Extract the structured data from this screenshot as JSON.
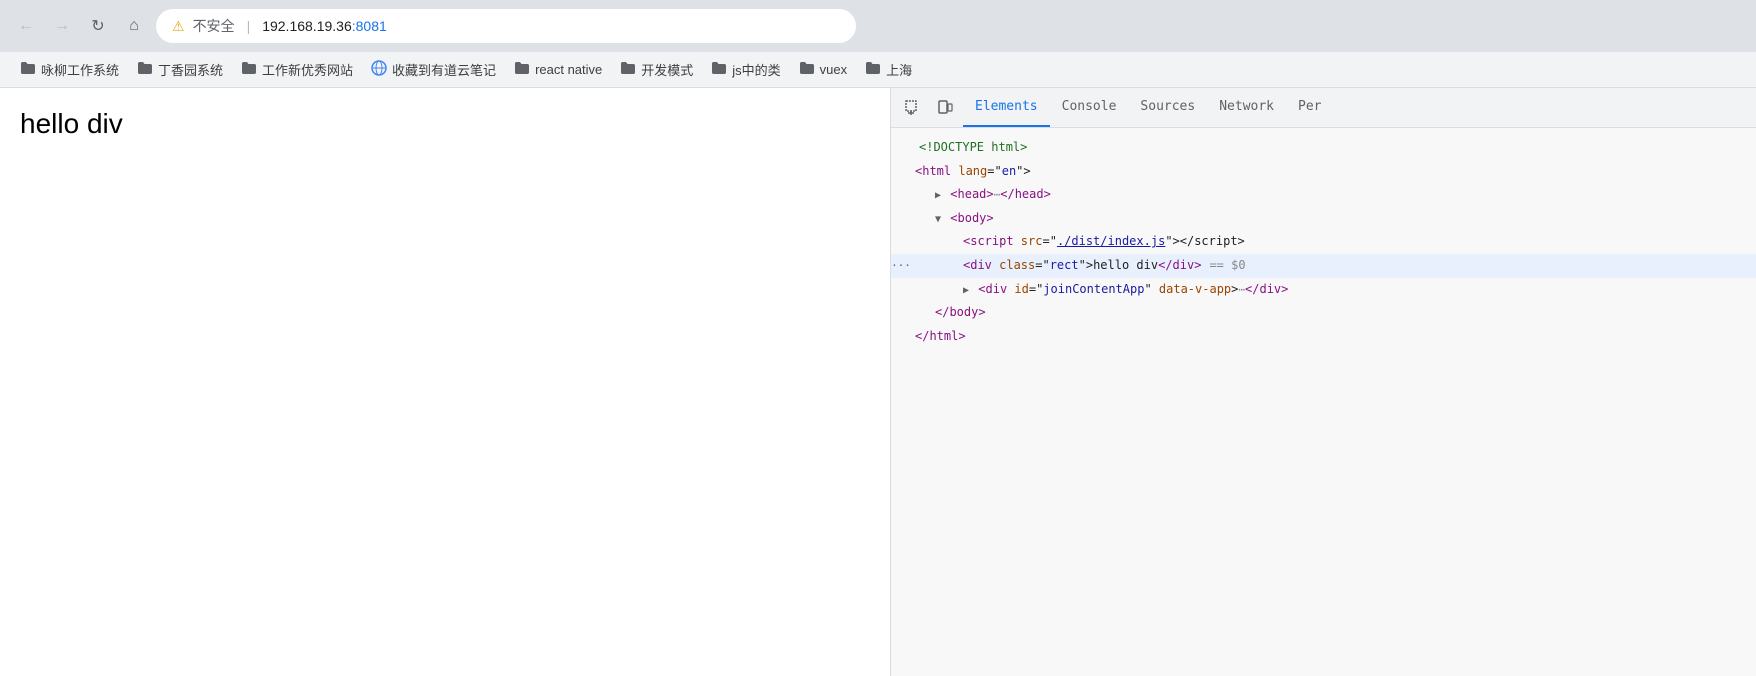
{
  "browser": {
    "back_disabled": true,
    "forward_disabled": true,
    "address": {
      "warning_label": "不安全",
      "separator": "|",
      "host": "192.168.19.36",
      "port": ":8081"
    },
    "bookmarks": [
      {
        "id": "b1",
        "icon": "folder",
        "label": "咏柳工作系统"
      },
      {
        "id": "b2",
        "icon": "folder",
        "label": "丁香园系统"
      },
      {
        "id": "b3",
        "icon": "folder",
        "label": "工作新优秀网站"
      },
      {
        "id": "b4",
        "icon": "globe",
        "label": "收藏到有道云笔记"
      },
      {
        "id": "b5",
        "icon": "folder",
        "label": "react native"
      },
      {
        "id": "b6",
        "icon": "folder",
        "label": "开发模式"
      },
      {
        "id": "b7",
        "icon": "folder",
        "label": "js中的类"
      },
      {
        "id": "b8",
        "icon": "folder",
        "label": "vuex"
      },
      {
        "id": "b9",
        "icon": "folder",
        "label": "上海"
      }
    ]
  },
  "page": {
    "content": "hello  div"
  },
  "devtools": {
    "icons": {
      "inspect": "⬚",
      "device": "⬜"
    },
    "tabs": [
      {
        "id": "elements",
        "label": "Elements",
        "active": true
      },
      {
        "id": "console",
        "label": "Console",
        "active": false
      },
      {
        "id": "sources",
        "label": "Sources",
        "active": false
      },
      {
        "id": "network",
        "label": "Network",
        "active": false
      },
      {
        "id": "performance",
        "label": "Per",
        "active": false
      }
    ],
    "dom": [
      {
        "id": "doctype",
        "indent": 0,
        "hasDots": false,
        "highlighted": false,
        "html": "comment",
        "raw": "<!DOCTYPE html>"
      },
      {
        "id": "html-open",
        "indent": 0,
        "hasDots": false,
        "highlighted": false,
        "html": "tag-with-attr",
        "tag": "html",
        "attrs": [
          {
            "name": "lang",
            "value": "en"
          }
        ]
      },
      {
        "id": "head",
        "indent": 1,
        "hasDots": true,
        "highlighted": false,
        "html": "collapsed",
        "tag": "head",
        "dotsBefore": "▶"
      },
      {
        "id": "body-open",
        "indent": 1,
        "hasDots": false,
        "highlighted": false,
        "html": "open-tag",
        "tag": "body",
        "arrow": "▼"
      },
      {
        "id": "script",
        "indent": 2,
        "hasDots": false,
        "highlighted": false,
        "html": "script-tag",
        "src": "./dist/index.js"
      },
      {
        "id": "div-rect",
        "indent": 2,
        "hasDots": true,
        "highlighted": true,
        "html": "div-rect",
        "class": "rect",
        "text": "hello div",
        "eqDollar": "== $0"
      },
      {
        "id": "div-join",
        "indent": 2,
        "hasDots": false,
        "highlighted": false,
        "html": "div-join",
        "arrow": "▶",
        "id_attr": "joinContentApp",
        "data_attr": "data-v-app"
      },
      {
        "id": "body-close",
        "indent": 1,
        "hasDots": false,
        "highlighted": false,
        "html": "close-tag",
        "tag": "body"
      },
      {
        "id": "html-close",
        "indent": 0,
        "hasDots": false,
        "highlighted": false,
        "html": "close-tag",
        "tag": "html"
      }
    ]
  }
}
